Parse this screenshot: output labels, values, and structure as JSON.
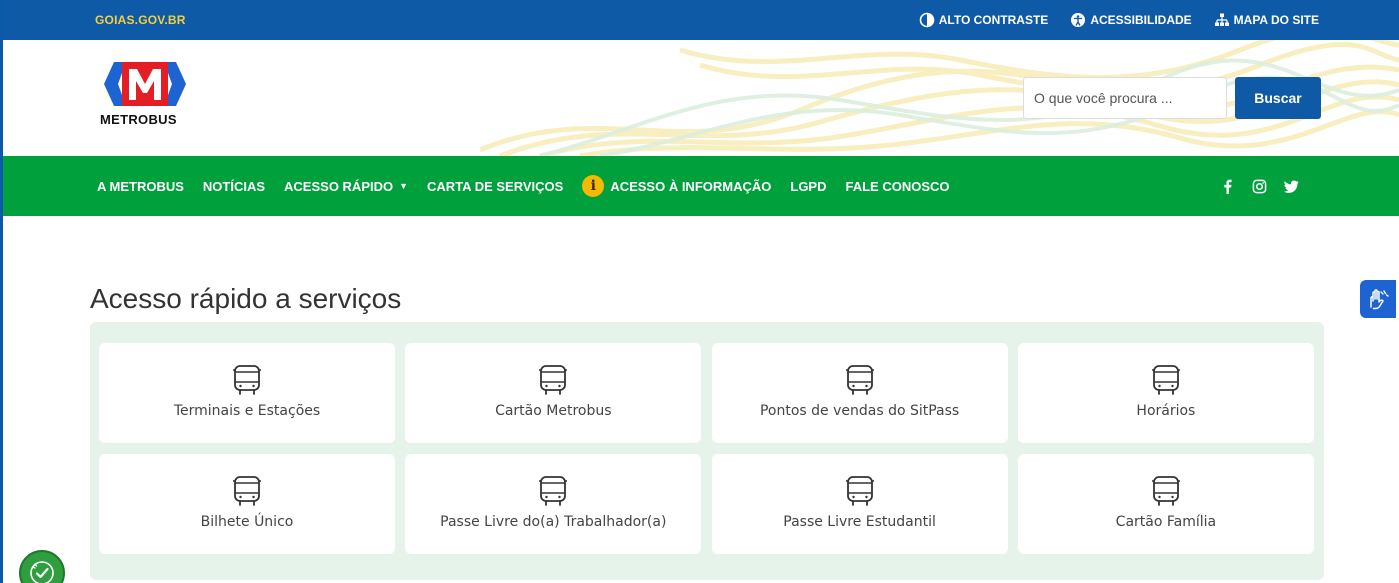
{
  "topbar": {
    "brand": "GOIAS.GOV.BR",
    "links": [
      {
        "label": "ALTO CONTRASTE",
        "icon": "contrast-icon"
      },
      {
        "label": "ACESSIBILIDADE",
        "icon": "accessibility-icon"
      },
      {
        "label": "MAPA DO SITE",
        "icon": "sitemap-icon"
      }
    ]
  },
  "header": {
    "logo_letter": "M",
    "logo_text": "METROBUS",
    "search_placeholder": "O que você procura ...",
    "search_button": "Buscar"
  },
  "nav": {
    "items": [
      {
        "label": "A METROBUS"
      },
      {
        "label": "NOTÍCIAS"
      },
      {
        "label": "ACESSO RÁPIDO",
        "dropdown": true
      },
      {
        "label": "CARTA DE SERVIÇOS"
      },
      {
        "label": "ACESSO À INFORMAÇÃO",
        "icon": "info-icon"
      },
      {
        "label": "LGPD"
      },
      {
        "label": "FALE CONOSCO"
      }
    ],
    "social": [
      "facebook-icon",
      "instagram-icon",
      "twitter-icon"
    ]
  },
  "section": {
    "title": "Acesso rápido a serviços",
    "cards": [
      {
        "label": "Terminais e Estações",
        "icon": "bus-icon"
      },
      {
        "label": "Cartão Metrobus",
        "icon": "bus-icon"
      },
      {
        "label": "Pontos de vendas do SitPass",
        "icon": "bus-icon"
      },
      {
        "label": "Horários",
        "icon": "bus-icon"
      },
      {
        "label": "Bilhete Único",
        "icon": "bus-icon"
      },
      {
        "label": "Passe Livre do(a) Trabalhador(a)",
        "icon": "bus-icon"
      },
      {
        "label": "Passe Livre Estudantil",
        "icon": "bus-icon"
      },
      {
        "label": "Cartão Família",
        "icon": "bus-icon"
      }
    ]
  },
  "colors": {
    "topbar": "#0f5aa6",
    "brand_yellow": "#f4d03f",
    "nav_green": "#00a03d",
    "panel_bg": "#e6f3ea",
    "logo_red": "#e31e24",
    "logo_blue": "#1e63d2",
    "vlibras_blue": "#1e63d2"
  }
}
